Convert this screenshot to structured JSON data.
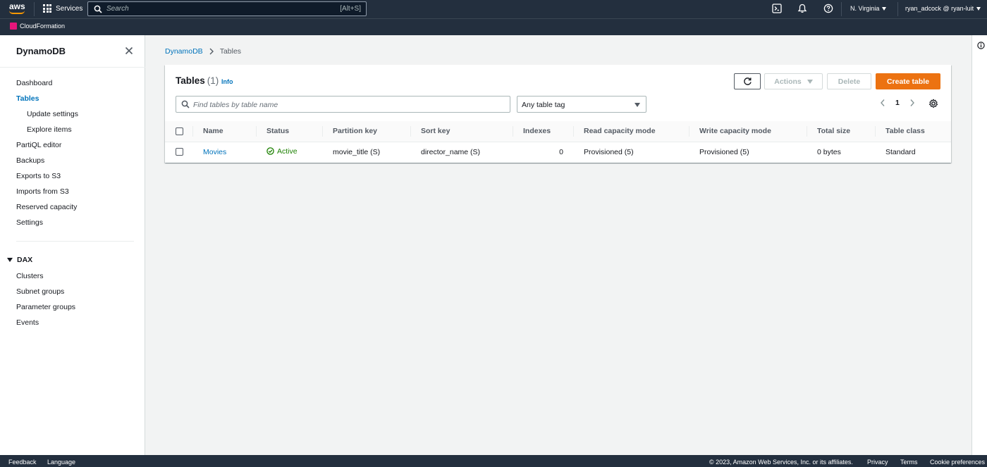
{
  "header": {
    "logo_text": "aws",
    "services_label": "Services",
    "search_placeholder": "Search",
    "search_shortcut": "[Alt+S]",
    "region": "N. Virginia",
    "user": "ryan_adcock @ ryan-luit",
    "favorite_service": "CloudFormation",
    "accent_color": "#ff9900"
  },
  "sidebar": {
    "title": "DynamoDB",
    "items": [
      {
        "label": "Dashboard"
      },
      {
        "label": "Tables",
        "active": true
      },
      {
        "label": "Update settings",
        "sub": true
      },
      {
        "label": "Explore items",
        "sub": true
      },
      {
        "label": "PartiQL editor"
      },
      {
        "label": "Backups"
      },
      {
        "label": "Exports to S3"
      },
      {
        "label": "Imports from S3"
      },
      {
        "label": "Reserved capacity"
      },
      {
        "label": "Settings"
      }
    ],
    "dax": {
      "title": "DAX",
      "items": [
        {
          "label": "Clusters"
        },
        {
          "label": "Subnet groups"
        },
        {
          "label": "Parameter groups"
        },
        {
          "label": "Events"
        }
      ]
    }
  },
  "breadcrumb": {
    "root": "DynamoDB",
    "current": "Tables"
  },
  "panel": {
    "title": "Tables",
    "count": "(1)",
    "info": "Info",
    "actions_label": "Actions",
    "delete_label": "Delete",
    "create_label": "Create table",
    "create_color": "#ec7211",
    "filter_placeholder": "Find tables by table name",
    "tag_select_value": "Any table tag",
    "page": "1"
  },
  "table": {
    "columns": [
      "Name",
      "Status",
      "Partition key",
      "Sort key",
      "Indexes",
      "Read capacity mode",
      "Write capacity mode",
      "Total size",
      "Table class"
    ],
    "rows": [
      {
        "name": "Movies",
        "status": "Active",
        "partition_key": "movie_title (S)",
        "sort_key": "director_name (S)",
        "indexes": "0",
        "read_mode": "Provisioned (5)",
        "write_mode": "Provisioned (5)",
        "total_size": "0 bytes",
        "table_class": "Standard"
      }
    ]
  },
  "footer": {
    "feedback": "Feedback",
    "language": "Language",
    "copyright": "© 2023, Amazon Web Services, Inc. or its affiliates.",
    "privacy": "Privacy",
    "terms": "Terms",
    "cookies": "Cookie preferences"
  }
}
